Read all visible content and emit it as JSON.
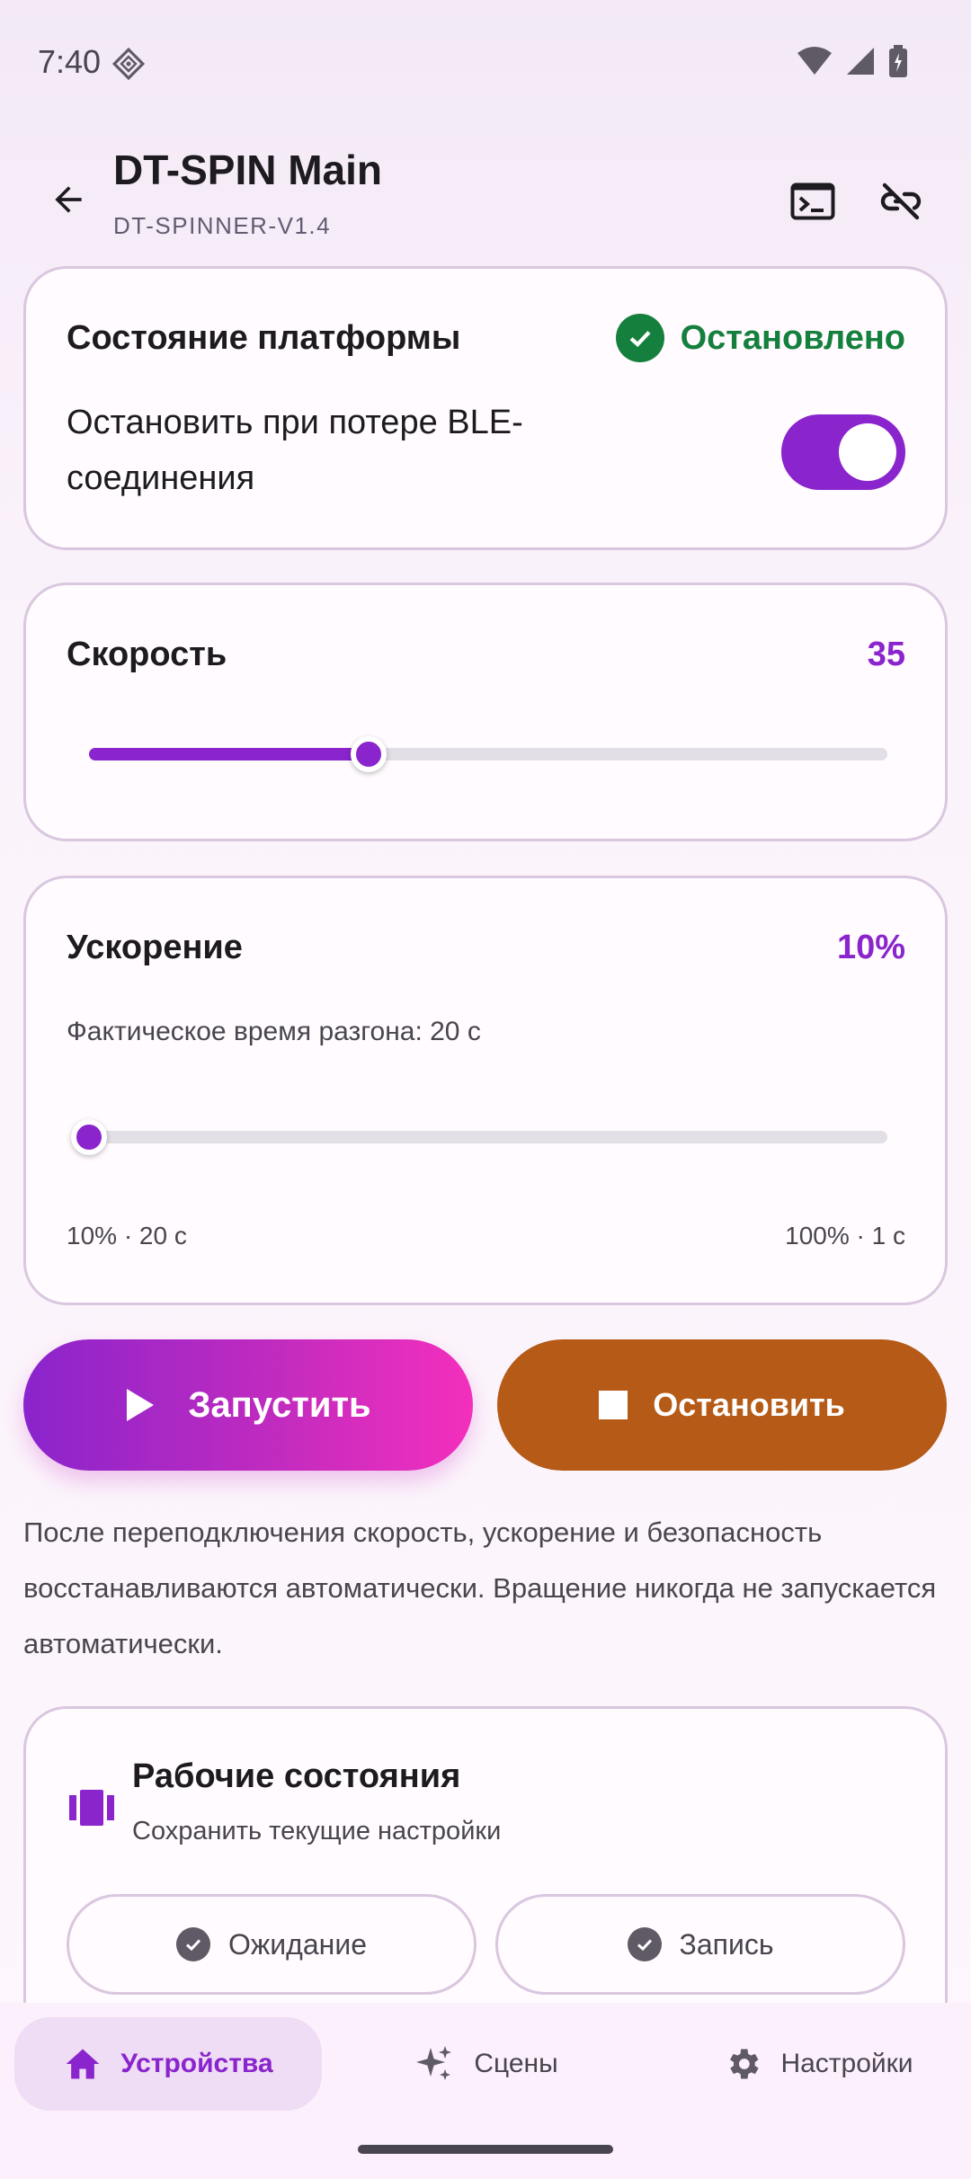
{
  "status_bar": {
    "time": "7:40"
  },
  "appbar": {
    "title": "DT-SPIN Main",
    "subtitle": "DT-SPINNER-V1.4"
  },
  "platform_card": {
    "title": "Состояние платформы",
    "state": "Остановлено",
    "stop_on_ble_loss_label": "Остановить при потере BLE-соединения",
    "stop_on_ble_loss_enabled": true,
    "state_color": "#15803d"
  },
  "speed_card": {
    "title": "Скорость",
    "value": "35",
    "slider_fraction": 0.35
  },
  "accel_card": {
    "title": "Ускорение",
    "value": "10%",
    "note": "Фактическое время разгона: 20 с",
    "range_min": "10% · 20 с",
    "range_max": "100% · 1 с",
    "slider_fraction": 0.0
  },
  "actions": {
    "start_label": "Запустить",
    "stop_label": "Остановить",
    "start_gradient": [
      "#8a24cc",
      "#f42fbd"
    ],
    "stop_color": "#b55a17"
  },
  "info_text": "После переподключения скорость, ускорение и безопасность восстанавливаются автоматически. Вращение никогда не запускается автоматически.",
  "work_states": {
    "title": "Рабочие состояния",
    "subtitle": "Сохранить текущие настройки",
    "chips": [
      {
        "label": "Ожидание",
        "icon": "check-circle-icon"
      },
      {
        "label": "Запись",
        "icon": "check-circle-icon"
      }
    ]
  },
  "bottom_nav": {
    "items": [
      {
        "label": "Устройства",
        "icon": "home-icon",
        "active": true
      },
      {
        "label": "Сцены",
        "icon": "sparkle-icon",
        "active": false
      },
      {
        "label": "Настройки",
        "icon": "gear-icon",
        "active": false
      }
    ]
  },
  "colors": {
    "accent": "#8a24cc",
    "success": "#15803d"
  }
}
